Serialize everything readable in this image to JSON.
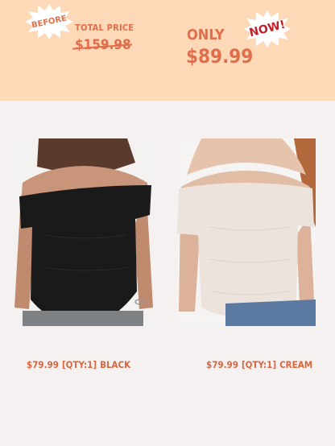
{
  "badges": {
    "before": "BEFORE",
    "now": "NOW!"
  },
  "pricing": {
    "total_label": "TOTAL PRICE",
    "old_price": "$159.98",
    "only_label": "ONLY",
    "new_price": "$89.99"
  },
  "products": [
    {
      "price": "$79.99",
      "qty": "[QTY:1]",
      "color": "BLACK"
    },
    {
      "price": "$79.99",
      "qty": "[QTY:1]",
      "color": "CREAM"
    }
  ],
  "colors": {
    "banner": "#fdd9b8",
    "accent": "#e26d4b",
    "now_text": "#c0202a",
    "page_bg": "#f6f1f1"
  }
}
